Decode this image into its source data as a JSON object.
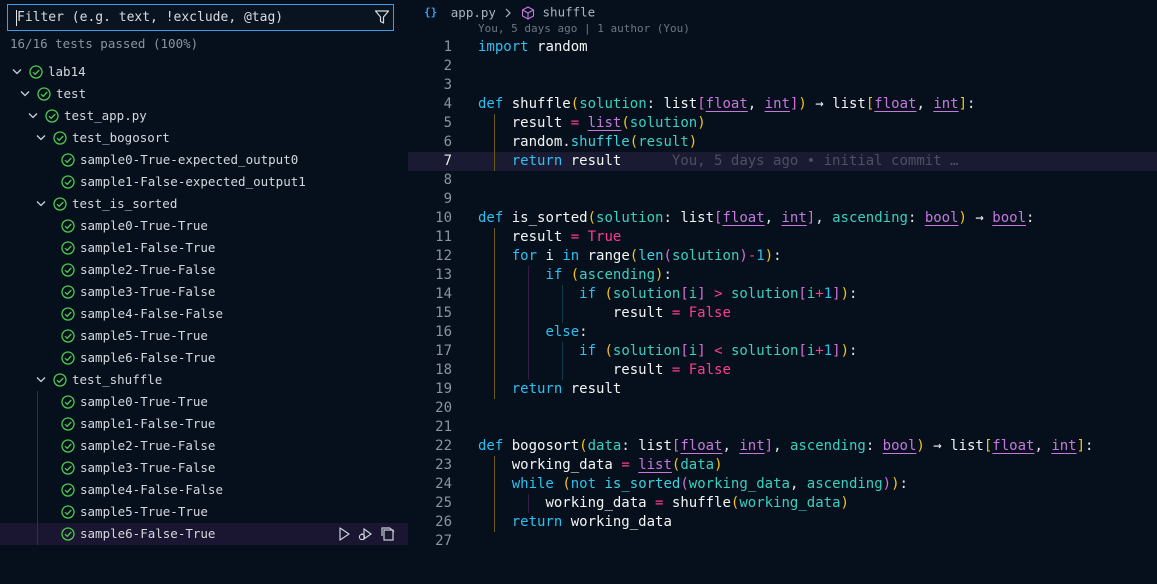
{
  "filter": {
    "placeholder": "Filter (e.g. text, !exclude, @tag)",
    "value": "",
    "icon": "filter-icon"
  },
  "summary": "16/16 tests passed (100%)",
  "tree": [
    {
      "label": "lab14",
      "level": 0,
      "expanded": true
    },
    {
      "label": "test",
      "level": 1,
      "expanded": true
    },
    {
      "label": "test_app.py",
      "level": 2,
      "expanded": true
    },
    {
      "label": "test_bogosort",
      "level": 3,
      "expanded": true
    },
    {
      "label": "sample0-True-expected_output0",
      "level": 4
    },
    {
      "label": "sample1-False-expected_output1",
      "level": 4
    },
    {
      "label": "test_is_sorted",
      "level": 3,
      "expanded": true
    },
    {
      "label": "sample0-True-True",
      "level": 4
    },
    {
      "label": "sample1-False-True",
      "level": 4
    },
    {
      "label": "sample2-True-False",
      "level": 4
    },
    {
      "label": "sample3-True-False",
      "level": 4
    },
    {
      "label": "sample4-False-False",
      "level": 4
    },
    {
      "label": "sample5-True-True",
      "level": 4
    },
    {
      "label": "sample6-False-True",
      "level": 4
    },
    {
      "label": "test_shuffle",
      "level": 3,
      "expanded": true
    },
    {
      "label": "sample0-True-True",
      "level": 4
    },
    {
      "label": "sample1-False-True",
      "level": 4
    },
    {
      "label": "sample2-True-False",
      "level": 4
    },
    {
      "label": "sample3-True-False",
      "level": 4
    },
    {
      "label": "sample4-False-False",
      "level": 4
    },
    {
      "label": "sample5-True-True",
      "level": 4
    },
    {
      "label": "sample6-False-True",
      "level": 4,
      "selected": true
    }
  ],
  "row_actions": [
    "run-test-icon",
    "debug-test-icon",
    "go-to-test-icon"
  ],
  "editor": {
    "breadcrumb_file": "app.py",
    "breadcrumb_symbol": "shuffle",
    "blame_header": "You, 5 days ago | 1 author (You)",
    "current_line": 7,
    "inline_blame": "You, 5 days ago • initial commit …"
  },
  "code_lines": [
    "import random",
    "",
    "",
    "def shuffle(solution: list[float, int]) → list[float, int]:",
    "    result = list(solution)",
    "    random.shuffle(result)",
    "    return result",
    "",
    "",
    "def is_sorted(solution: list[float, int], ascending: bool) → bool:",
    "    result = True",
    "    for i in range(len(solution)-1):",
    "        if (ascending):",
    "            if (solution[i] > solution[i+1]):",
    "                result = False",
    "        else:",
    "            if (solution[i] < solution[i+1]):",
    "                result = False",
    "    return result",
    "",
    "",
    "def bogosort(data: list[float, int], ascending: bool) → list[float, int]:",
    "    working_data = list(data)",
    "    while (not is_sorted(working_data, ascending)):",
    "        working_data = shuffle(working_data)",
    "    return working_data",
    ""
  ],
  "colors": {
    "keyword": "#2cc0f0",
    "type": "#c678dd",
    "operator": "#ff3d8f",
    "param": "#3ad0c0",
    "bracket_outer": "#f5c518",
    "pass_icon": "#4ec94e",
    "filter_border": "#3d9be9",
    "selected_row": "#1a1530",
    "current_line": "#1b1a33"
  }
}
